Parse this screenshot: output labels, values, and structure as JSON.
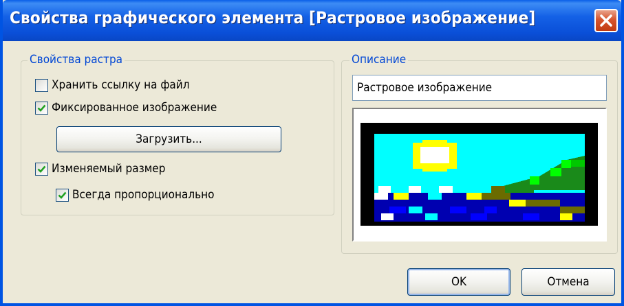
{
  "window": {
    "title": "Свойства графического элемента [Растровое изображение]"
  },
  "raster_group": {
    "legend": "Свойства растра",
    "store_link": {
      "label": "Хранить ссылку на файл",
      "checked": false
    },
    "fixed_image": {
      "label": "Фиксированное изображение",
      "checked": true
    },
    "load_button": "Загрузить...",
    "resizable": {
      "label": "Изменяемый размер",
      "checked": true
    },
    "proportional": {
      "label": "Всегда пропорционально",
      "checked": true
    }
  },
  "description_group": {
    "legend": "Описание",
    "value": "Растровое изображение"
  },
  "buttons": {
    "ok": "OK",
    "cancel": "Отмена"
  },
  "colors": {
    "titlebar": "#0054e3",
    "legend_text": "#0046d5",
    "close": "#d6552f"
  },
  "icons": [
    "close-icon",
    "check-icon"
  ]
}
